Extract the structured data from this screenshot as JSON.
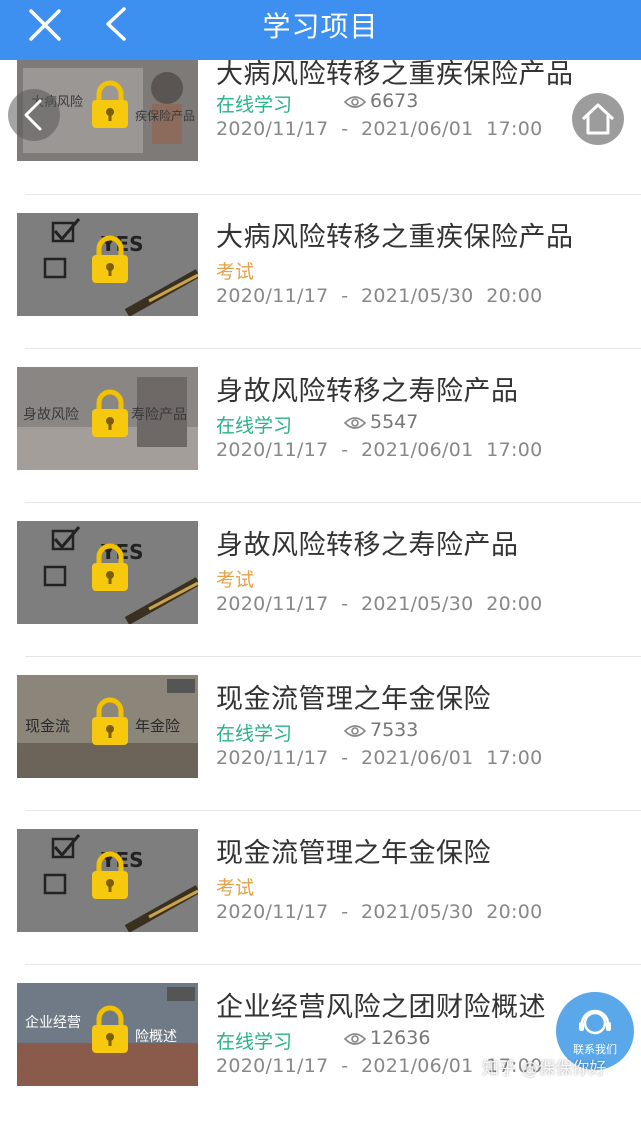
{
  "header": {
    "title": "学习项目"
  },
  "items": [
    {
      "title": "大病风险转移之重疾保险产品",
      "type": "在线学习",
      "views": "6673",
      "date": "2020/11/17  -  2021/06/01  17:00",
      "thumb_text": "大病风险",
      "thumb_text2": "疾保险产品"
    },
    {
      "title": "大病风险转移之重疾保险产品",
      "type": "考试",
      "views": "",
      "date": "2020/11/17  -  2021/05/30  20:00",
      "thumb_text": "YES",
      "thumb_text2": ""
    },
    {
      "title": "身故风险转移之寿险产品",
      "type": "在线学习",
      "views": "5547",
      "date": "2020/11/17  -  2021/06/01  17:00",
      "thumb_text": "身故风险",
      "thumb_text2": "寿险产品"
    },
    {
      "title": "身故风险转移之寿险产品",
      "type": "考试",
      "views": "",
      "date": "2020/11/17  -  2021/05/30  20:00",
      "thumb_text": "YES",
      "thumb_text2": ""
    },
    {
      "title": "现金流管理之年金保险",
      "type": "在线学习",
      "views": "7533",
      "date": "2020/11/17  -  2021/06/01  17:00",
      "thumb_text": "现金流",
      "thumb_text2": "年金险"
    },
    {
      "title": "现金流管理之年金保险",
      "type": "考试",
      "views": "",
      "date": "2020/11/17  -  2021/05/30  20:00",
      "thumb_text": "YES",
      "thumb_text2": ""
    },
    {
      "title": "企业经营风险之团财险概述",
      "type": "在线学习",
      "views": "12636",
      "date": "2020/11/17  -  2021/06/01  17:00",
      "thumb_text": "企业经营",
      "thumb_text2": "险概述"
    }
  ],
  "contact": {
    "label": "联系我们"
  },
  "watermark": "知乎 @保保你好",
  "colors": {
    "header": "#3d8ff0",
    "study": "#26b38a",
    "exam": "#e6a24a"
  }
}
